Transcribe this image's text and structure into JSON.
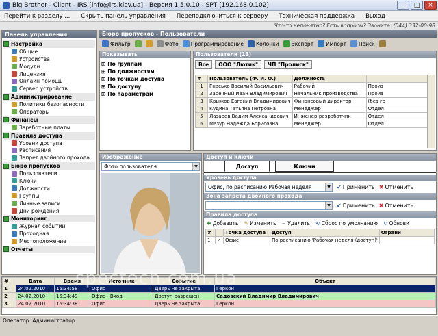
{
  "window": {
    "title": "Big Brother - Client - IRS [info@irs.kiev.ua] - Версия 1.5.0.10 - SPT (192.168.0.102)"
  },
  "menu": [
    "Перейти к разделу ...",
    "Скрыть панель управления",
    "Переподключиться к серверу",
    "Техническая поддержка",
    "Выход"
  ],
  "info_line": "Что-то непонятно? Есть вопросы? Звоните: (044) 332-00-98",
  "sidebar": {
    "title": "Панель управления",
    "groups": [
      {
        "label": "Настройка",
        "items": [
          "Общие",
          "Устройства",
          "Модули",
          "Лицензия",
          "Онлайн помощь",
          "Сервер устройств"
        ]
      },
      {
        "label": "Администрирование",
        "items": [
          "Политики безопасности",
          "Операторы"
        ]
      },
      {
        "label": "Финансы",
        "items": [
          "Заработные платы"
        ]
      },
      {
        "label": "Правила доступа",
        "items": [
          "Уровни доступа",
          "Расписания",
          "Запрет двойного прохода"
        ]
      },
      {
        "label": "Бюро пропусков",
        "items": [
          "Пользователи",
          "Ключи",
          "Должности",
          "Группы",
          "Личные записи",
          "Дни рождения"
        ]
      },
      {
        "label": "Мониторинг",
        "items": [
          "Журнал событий",
          "Проходная",
          "Местоположение"
        ]
      },
      {
        "label": "Отчеты",
        "items": []
      }
    ]
  },
  "main": {
    "title": "Бюро пропусков - Пользователи",
    "toolbar": [
      "Фильтр",
      "Фото",
      "Программирование",
      "Колонки",
      "Экспорт",
      "Импорт",
      "Поиск"
    ],
    "show": {
      "title": "Показывать",
      "items": [
        "По группам",
        "По должностям",
        "По точкам доступа",
        "По доступу",
        "По параметрам"
      ]
    },
    "users": {
      "title": "Пользователи (13)",
      "filters": [
        "Все",
        "ООО \"Лютик\"",
        "ЧП \"Пролиск\""
      ],
      "columns": [
        "#",
        "Пользователь (Ф. И. О.)",
        "Должность",
        ""
      ],
      "rows": [
        [
          "1",
          "Гнасько Василий Васильевич",
          "Рабочий",
          "Произ"
        ],
        [
          "2",
          "Заречный Иван Владимирович",
          "Начальник производства",
          "Произ"
        ],
        [
          "3",
          "Крыжов Евгений Владимирович",
          "Финансовый директор",
          "(без гр"
        ],
        [
          "4",
          "Кудина Татьяна Петровна",
          "Менеджер",
          "Отдел"
        ],
        [
          "5",
          "Лазарев Вадим Александрович",
          "Инженер-разработчик",
          "Отдел"
        ],
        [
          "6",
          "Мазур Надежда Борисовна",
          "Менеджер",
          "Отдел"
        ]
      ]
    },
    "image": {
      "title": "Изображение",
      "select": "Фото пользователя"
    },
    "access": {
      "title": "Доступ и ключи",
      "tabs": [
        "Доступ",
        "Ключи"
      ],
      "level_title": "Уровень доступа",
      "level_value": "Офис, по расписанию Рабочая неделя",
      "zone_title": "Зона запрета двойного прохода",
      "apply": "Применить",
      "cancel": "Отменить",
      "rules_title": "Правила доступа",
      "rules_toolbar": [
        "Добавить",
        "Изменить",
        "Удалить",
        "Сброс по умолчанию",
        "Обнови"
      ],
      "rules_columns": [
        "#",
        "",
        "Точка доступа",
        "Доступ",
        "Ограни"
      ],
      "rules_rows": [
        [
          "1",
          "✓",
          "Офис",
          "По расписанию 'Рабочая неделя (доступ)'",
          ""
        ]
      ]
    }
  },
  "events": {
    "columns": [
      "#",
      "Дата",
      "Время",
      "Источник",
      "Событие",
      "Объект"
    ],
    "rows": [
      [
        "1",
        "24.02.2010",
        "15:34:58",
        "Офис",
        "Дверь не закрыта",
        "Геркон"
      ],
      [
        "2",
        "24.02.2010",
        "15:34:49",
        "Офис - Вход",
        "Доступ разрешен",
        "Садовский Владимир Владимирович"
      ],
      [
        "3",
        "24.02.2010",
        "15:34:38",
        "Офис",
        "Дверь не закрыта",
        "Геркон"
      ]
    ]
  },
  "status": {
    "operator": "Оператор: Администратор"
  },
  "watermark": "spectech.com.ua",
  "colors": {
    "event_row_1": "#0a246a",
    "event_row_2": "#b8f0b8",
    "event_row_3": "#f5c6c6",
    "selected_tab": "#ffffff"
  }
}
